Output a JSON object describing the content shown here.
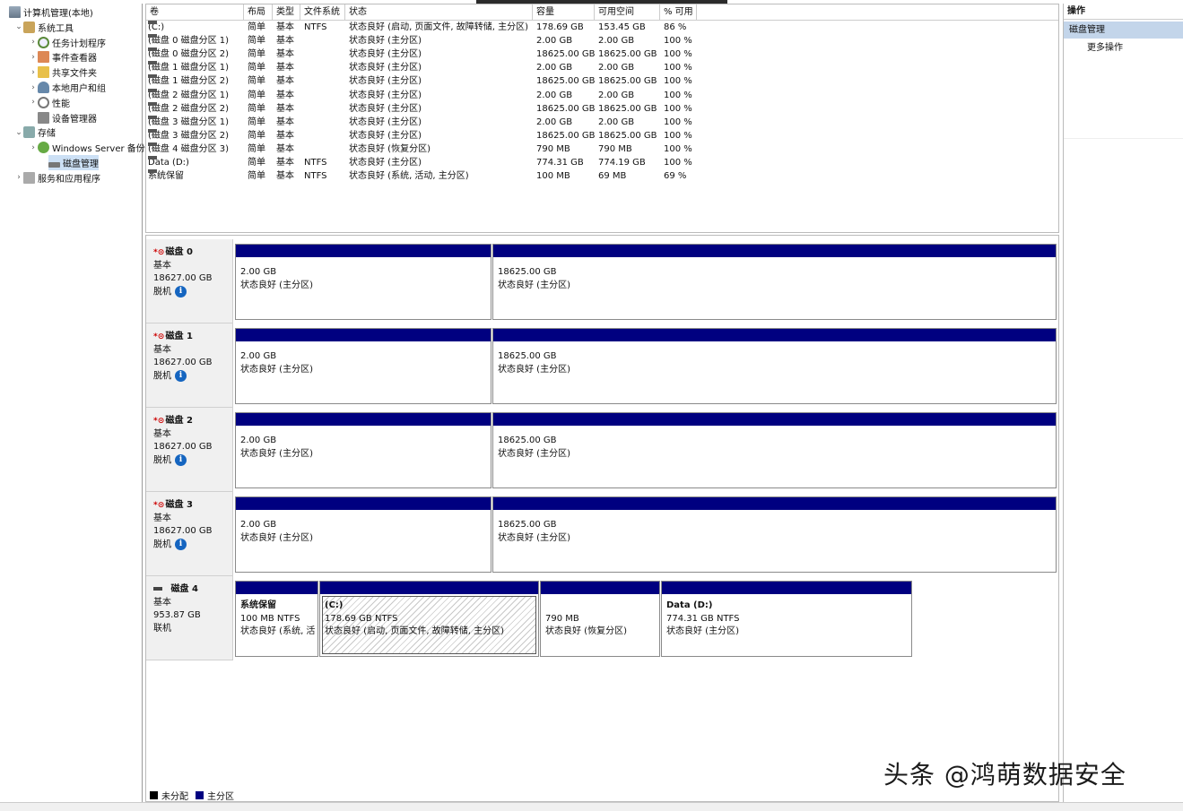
{
  "tree": [
    {
      "label": "计算机管理(本地)",
      "icon": "computer-icon",
      "indent": 0,
      "arrow": ""
    },
    {
      "label": "系统工具",
      "icon": "tools-icon",
      "indent": 1,
      "arrow": "⌄"
    },
    {
      "label": "任务计划程序",
      "icon": "clock-icon",
      "indent": 2,
      "arrow": "›"
    },
    {
      "label": "事件查看器",
      "icon": "event-log-icon",
      "indent": 2,
      "arrow": "›"
    },
    {
      "label": "共享文件夹",
      "icon": "shared-folder-icon",
      "indent": 2,
      "arrow": "›"
    },
    {
      "label": "本地用户和组",
      "icon": "users-icon",
      "indent": 2,
      "arrow": "›"
    },
    {
      "label": "性能",
      "icon": "performance-icon",
      "indent": 2,
      "arrow": "›"
    },
    {
      "label": "设备管理器",
      "icon": "device-manager-icon",
      "indent": 2,
      "arrow": ""
    },
    {
      "label": "存储",
      "icon": "storage-icon",
      "indent": 1,
      "arrow": "⌄"
    },
    {
      "label": "Windows Server 备份",
      "icon": "backup-icon",
      "indent": 2,
      "arrow": "›"
    },
    {
      "label": "磁盘管理",
      "icon": "disk-management-icon",
      "indent": 2,
      "arrow": "",
      "selected": true
    },
    {
      "label": "服务和应用程序",
      "icon": "services-icon",
      "indent": 1,
      "arrow": "›"
    }
  ],
  "volumes": {
    "headers": [
      "卷",
      "布局",
      "类型",
      "文件系统",
      "状态",
      "容量",
      "可用空间",
      "% 可用"
    ],
    "rows": [
      [
        "(C:)",
        "简单",
        "基本",
        "NTFS",
        "状态良好 (启动, 页面文件, 故障转储, 主分区)",
        "178.69 GB",
        "153.45 GB",
        "86 %"
      ],
      [
        "(磁盘 0 磁盘分区 1)",
        "简单",
        "基本",
        "",
        "状态良好 (主分区)",
        "2.00 GB",
        "2.00 GB",
        "100 %"
      ],
      [
        "(磁盘 0 磁盘分区 2)",
        "简单",
        "基本",
        "",
        "状态良好 (主分区)",
        "18625.00 GB",
        "18625.00 GB",
        "100 %"
      ],
      [
        "(磁盘 1 磁盘分区 1)",
        "简单",
        "基本",
        "",
        "状态良好 (主分区)",
        "2.00 GB",
        "2.00 GB",
        "100 %"
      ],
      [
        "(磁盘 1 磁盘分区 2)",
        "简单",
        "基本",
        "",
        "状态良好 (主分区)",
        "18625.00 GB",
        "18625.00 GB",
        "100 %"
      ],
      [
        "(磁盘 2 磁盘分区 1)",
        "简单",
        "基本",
        "",
        "状态良好 (主分区)",
        "2.00 GB",
        "2.00 GB",
        "100 %"
      ],
      [
        "(磁盘 2 磁盘分区 2)",
        "简单",
        "基本",
        "",
        "状态良好 (主分区)",
        "18625.00 GB",
        "18625.00 GB",
        "100 %"
      ],
      [
        "(磁盘 3 磁盘分区 1)",
        "简单",
        "基本",
        "",
        "状态良好 (主分区)",
        "2.00 GB",
        "2.00 GB",
        "100 %"
      ],
      [
        "(磁盘 3 磁盘分区 2)",
        "简单",
        "基本",
        "",
        "状态良好 (主分区)",
        "18625.00 GB",
        "18625.00 GB",
        "100 %"
      ],
      [
        "(磁盘 4 磁盘分区 3)",
        "简单",
        "基本",
        "",
        "状态良好 (恢复分区)",
        "790 MB",
        "790 MB",
        "100 %"
      ],
      [
        "Data (D:)",
        "简单",
        "基本",
        "NTFS",
        "状态良好 (主分区)",
        "774.31 GB",
        "774.19 GB",
        "100 %"
      ],
      [
        "系统保留",
        "简单",
        "基本",
        "NTFS",
        "状态良好 (系统, 活动, 主分区)",
        "100 MB",
        "69 MB",
        "69 %"
      ]
    ]
  },
  "disks": [
    {
      "name": "磁盘 0",
      "type": "基本",
      "size": "18627.00 GB",
      "status": "脱机",
      "offline": true,
      "partitions": [
        {
          "name": "",
          "size": "2.00 GB",
          "status": "状态良好 (主分区)"
        },
        {
          "name": "",
          "size": "18625.00 GB",
          "status": "状态良好 (主分区)"
        }
      ]
    },
    {
      "name": "磁盘 1",
      "type": "基本",
      "size": "18627.00 GB",
      "status": "脱机",
      "offline": true,
      "partitions": [
        {
          "name": "",
          "size": "2.00 GB",
          "status": "状态良好 (主分区)"
        },
        {
          "name": "",
          "size": "18625.00 GB",
          "status": "状态良好 (主分区)"
        }
      ]
    },
    {
      "name": "磁盘 2",
      "type": "基本",
      "size": "18627.00 GB",
      "status": "脱机",
      "offline": true,
      "partitions": [
        {
          "name": "",
          "size": "2.00 GB",
          "status": "状态良好 (主分区)"
        },
        {
          "name": "",
          "size": "18625.00 GB",
          "status": "状态良好 (主分区)"
        }
      ]
    },
    {
      "name": "磁盘 3",
      "type": "基本",
      "size": "18627.00 GB",
      "status": "脱机",
      "offline": true,
      "partitions": [
        {
          "name": "",
          "size": "2.00 GB",
          "status": "状态良好 (主分区)"
        },
        {
          "name": "",
          "size": "18625.00 GB",
          "status": "状态良好 (主分区)"
        }
      ]
    },
    {
      "name": "磁盘 4",
      "type": "基本",
      "size": "953.87 GB",
      "status": "联机",
      "offline": false,
      "partitions": [
        {
          "name": "系统保留",
          "size": "100 MB NTFS",
          "status": "状态良好 (系统, 活动, 主分区)"
        },
        {
          "name": "(C:)",
          "size": "178.69 GB NTFS",
          "status": "状态良好 (启动, 页面文件, 故障转储, 主分区)",
          "selected": true
        },
        {
          "name": "",
          "size": "790 MB",
          "status": "状态良好 (恢复分区)"
        },
        {
          "name": "Data  (D:)",
          "size": "774.31 GB NTFS",
          "status": "状态良好 (主分区)"
        }
      ]
    }
  ],
  "legend": [
    {
      "label": "未分配",
      "color": "#000000"
    },
    {
      "label": "主分区",
      "color": "#000080"
    }
  ],
  "actions": {
    "title": "操作",
    "selected": "磁盘管理",
    "more": "更多操作"
  },
  "watermark": "头条 @鸿萌数据安全",
  "colors": {
    "partition_bar": "#000080",
    "selection": "#cce0f5",
    "info_icon": "#1565c0"
  }
}
